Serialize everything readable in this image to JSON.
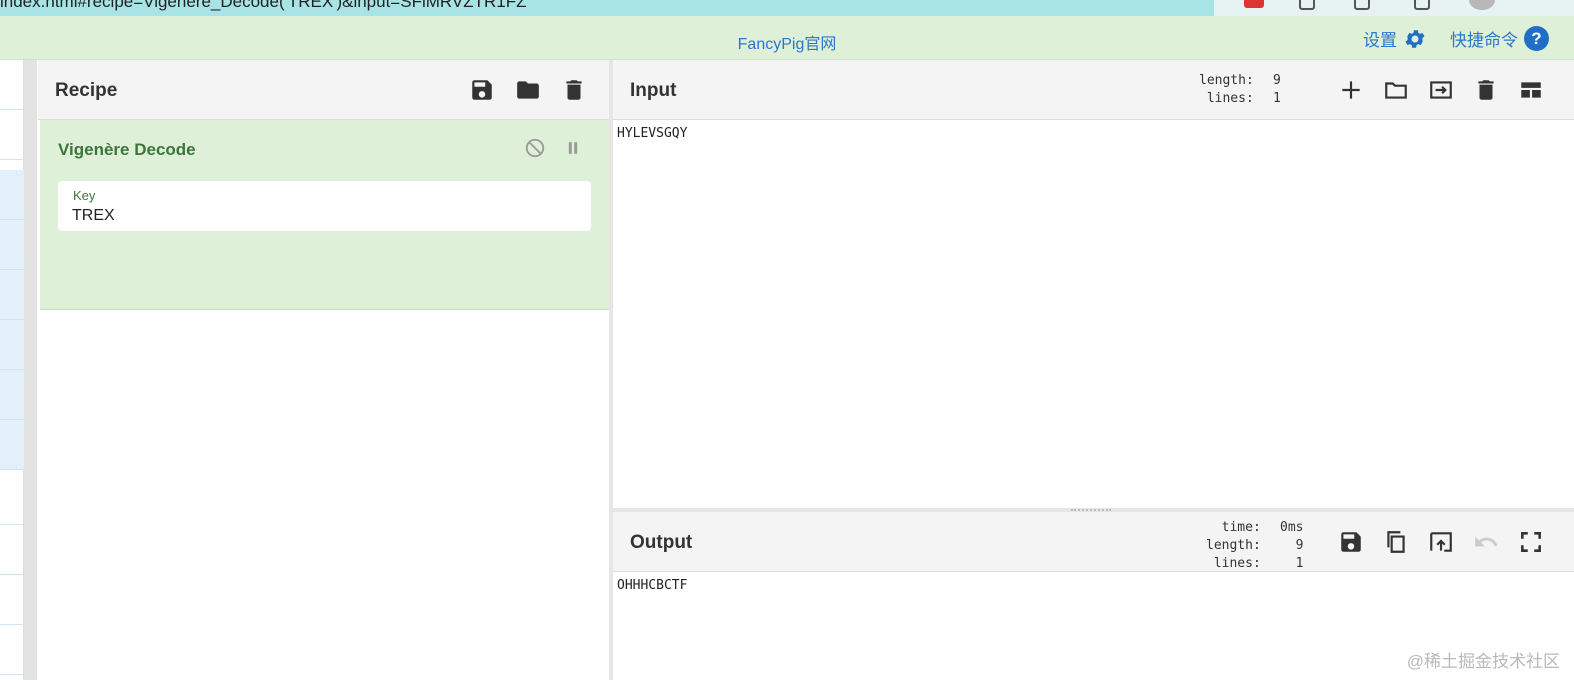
{
  "browser": {
    "url": "index.html#recipe=Vigenère_Decode('TREX')&input=SFlMRVZTR1FZ"
  },
  "banner": {
    "center_link": "FancyPig官网",
    "settings_label": "设置",
    "shortcuts_label": "快捷命令"
  },
  "recipe": {
    "title": "Recipe",
    "operation": {
      "name": "Vigenère Decode",
      "key_label": "Key",
      "key_value": "TREX"
    }
  },
  "input": {
    "title": "Input",
    "stats_labels": "length:\nlines:",
    "stats_values": "9\n1",
    "text": "HYLEVSGQY"
  },
  "output": {
    "title": "Output",
    "stats_labels": "time:\nlength:\nlines:",
    "stats_values": "0ms\n9\n1",
    "text": "OHHHCBCTF"
  },
  "watermark": "@稀土掘金技术社区",
  "colors": {
    "banner_bg": "#dff0d8",
    "link_blue": "#2a78c8",
    "operation_green": "#3c763d",
    "browser_bar": "#a8e4e6"
  }
}
